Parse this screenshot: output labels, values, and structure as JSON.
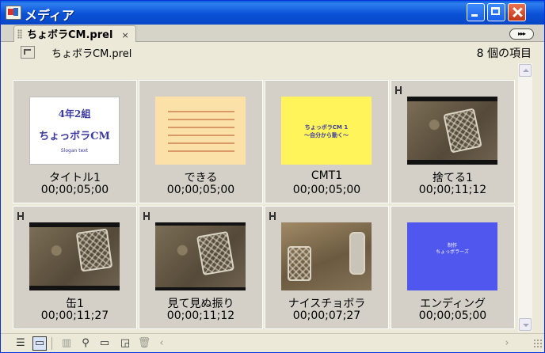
{
  "window": {
    "title": "メディア"
  },
  "tab": {
    "label": "ちょボラCM.prel",
    "close_glyph": "×",
    "menu_glyph": "▸▸▸"
  },
  "info": {
    "bin_name": "ちょボラCM.prel",
    "item_count": "8 個の項目"
  },
  "items": [
    {
      "name": "タイトル1",
      "duration": "00;00;05;00",
      "kind": "title",
      "thumb_text": [
        "4年2組",
        "ちょっボラCM",
        "Slogan text"
      ]
    },
    {
      "name": "できる",
      "duration": "00;00;05;00",
      "kind": "text-card"
    },
    {
      "name": "CMT1",
      "duration": "00;00;05;00",
      "kind": "yellow-card",
      "thumb_text": [
        "ちょっボラCM 1",
        "～自分から動く～"
      ]
    },
    {
      "name": "捨てる1",
      "duration": "00;00;11;12",
      "kind": "video"
    },
    {
      "name": "缶1",
      "duration": "00;00;11;27",
      "kind": "video"
    },
    {
      "name": "見て見ぬ振り",
      "duration": "00;00;11;12",
      "kind": "video"
    },
    {
      "name": "ナイスチョボラ",
      "duration": "00;00;07;27",
      "kind": "video"
    },
    {
      "name": "エンディング",
      "duration": "00;00;05;00",
      "kind": "ending",
      "thumb_text": [
        "制作",
        "ちょっボラーズ"
      ]
    }
  ],
  "toolbar": {
    "list_view": "list-view-icon",
    "icon_view": "icon-view-icon",
    "automate": "automate-icon",
    "find": "find-icon",
    "new_bin": "new-bin-icon",
    "new_item": "new-item-icon",
    "clear": "trash-icon"
  },
  "colors": {
    "titlebar": "#0a52d8",
    "close_button": "#c2341a",
    "cell_bg": "#d4d0c8",
    "ending_thumb": "#5057ee",
    "cmt_thumb": "#fff45a",
    "dekiru_thumb": "#fbe1a8"
  }
}
